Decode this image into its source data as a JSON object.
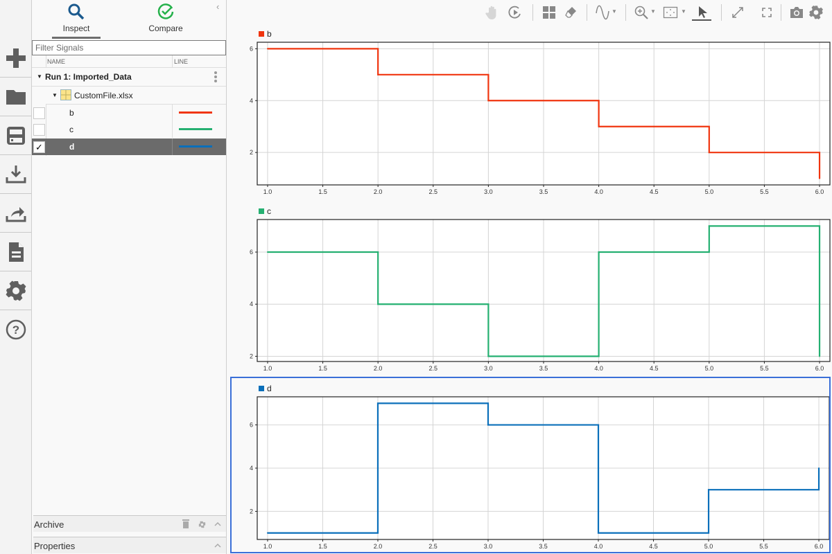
{
  "rail": {
    "items": [
      {
        "name": "new-session",
        "icon": "plus-icon"
      },
      {
        "name": "open",
        "icon": "folder-icon"
      },
      {
        "name": "save",
        "icon": "save-icon"
      },
      {
        "name": "import",
        "icon": "download-icon"
      },
      {
        "name": "export",
        "icon": "share-icon"
      },
      {
        "name": "report",
        "icon": "document-icon"
      },
      {
        "name": "preferences",
        "icon": "gear-icon"
      },
      {
        "name": "help",
        "icon": "help-icon"
      }
    ]
  },
  "panel": {
    "tabs": [
      {
        "label": "Inspect",
        "icon": "search-icon",
        "active": true,
        "color": "#1b5a8e"
      },
      {
        "label": "Compare",
        "icon": "check-circle-icon",
        "active": false,
        "color": "#25b14b"
      }
    ],
    "collapse_glyph": "‹",
    "filter_placeholder": "Filter Signals",
    "columns": {
      "name": "NAME",
      "line": "LINE"
    },
    "run": {
      "label": "Run 1: Imported_Data"
    },
    "file": {
      "label": "CustomFile.xlsx"
    },
    "signals": [
      {
        "name": "b",
        "checked": false,
        "selected": false,
        "color": "#f0350f"
      },
      {
        "name": "c",
        "checked": false,
        "selected": false,
        "color": "#25b071"
      },
      {
        "name": "d",
        "checked": true,
        "selected": true,
        "color": "#0a6fba"
      }
    ],
    "archive": {
      "label": "Archive"
    },
    "properties": {
      "label": "Properties"
    }
  },
  "toolbar": {
    "items": [
      "pan",
      "replay",
      "layout",
      "clear",
      "signal-style",
      "zoom-in",
      "fit-to-view",
      "cursor",
      "expand",
      "fullscreen",
      "snapshot",
      "settings"
    ]
  },
  "chart_data": [
    {
      "type": "line",
      "step": true,
      "title": "b",
      "legend": "top-left",
      "color": "#f0350f",
      "x": [
        1,
        2,
        3,
        4,
        5,
        6
      ],
      "values": [
        6,
        5,
        4,
        3,
        2,
        1
      ],
      "xlim": [
        0.906,
        6.094
      ],
      "ylim": [
        0.75,
        6.25
      ],
      "xticks": [
        "1.0",
        "1.5",
        "2.0",
        "2.5",
        "3.0",
        "3.5",
        "4.0",
        "4.5",
        "5.0",
        "5.5",
        "6.0"
      ],
      "yticks": [
        "2",
        "4",
        "6"
      ],
      "grid": true
    },
    {
      "type": "line",
      "step": true,
      "title": "c",
      "legend": "top-left",
      "color": "#25b071",
      "x": [
        1,
        2,
        3,
        4,
        5,
        6
      ],
      "values": [
        6,
        4,
        2,
        6,
        7,
        2
      ],
      "xlim": [
        0.906,
        6.094
      ],
      "ylim": [
        1.8,
        7.25
      ],
      "xticks": [
        "1.0",
        "1.5",
        "2.0",
        "2.5",
        "3.0",
        "3.5",
        "4.0",
        "4.5",
        "5.0",
        "5.5",
        "6.0"
      ],
      "yticks": [
        "2",
        "4",
        "6"
      ],
      "grid": true
    },
    {
      "type": "line",
      "step": true,
      "title": "d",
      "legend": "top-left",
      "color": "#0a6fba",
      "selected": true,
      "x": [
        1,
        2,
        3,
        4,
        5,
        6
      ],
      "values": [
        1,
        7,
        6,
        1,
        3,
        4
      ],
      "xlim": [
        0.906,
        6.094
      ],
      "ylim": [
        0.7,
        7.3
      ],
      "xticks": [
        "1.0",
        "1.5",
        "2.0",
        "2.5",
        "3.0",
        "3.5",
        "4.0",
        "4.5",
        "5.0",
        "5.5",
        "6.0"
      ],
      "yticks": [
        "2",
        "4",
        "6"
      ],
      "grid": true
    }
  ]
}
